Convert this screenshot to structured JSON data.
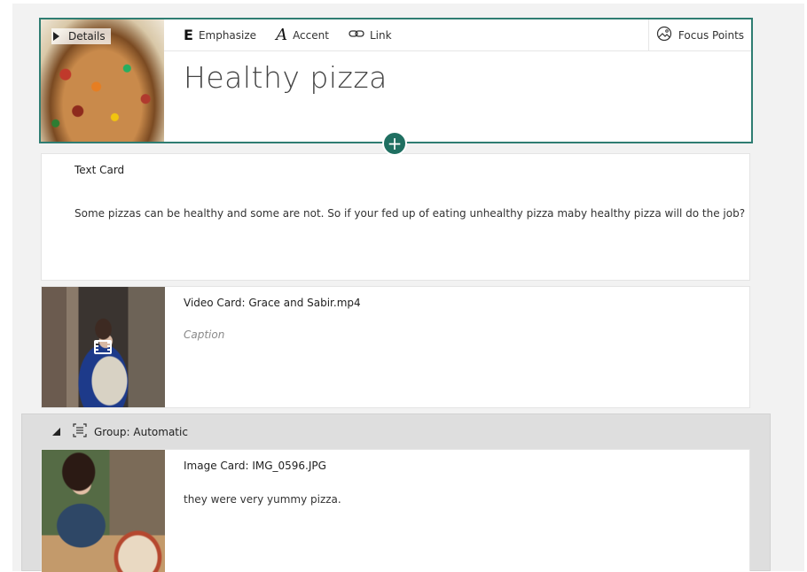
{
  "title_card": {
    "details_label": "Details",
    "toolbar": {
      "emphasize_glyph": "E",
      "emphasize_label": "Emphasize",
      "accent_glyph": "A",
      "accent_label": "Accent",
      "link_label": "Link",
      "focus_points_label": "Focus Points"
    },
    "title": "Healthy pizza",
    "add_symbol": "+"
  },
  "text_card": {
    "heading": "Text Card",
    "body": "Some pizzas can be healthy and some are not. So if your fed up of eating unhealthy pizza maby healthy pizza will do the job?"
  },
  "video_card": {
    "heading": "Video Card: Grace and Sabir.mp4",
    "caption_placeholder": "Caption"
  },
  "group": {
    "label": "Group: Automatic"
  },
  "image_card": {
    "heading": "Image Card: IMG_0596.JPG",
    "body": "they were very yummy pizza."
  },
  "colors": {
    "accent": "#2f7d72",
    "add_button": "#1f6f61",
    "canvas": "#f2f2f2",
    "group_bg": "#dedede"
  },
  "icons": {
    "details": "triangle-right-icon",
    "link": "link-icon",
    "focus_points": "focus-points-icon",
    "video": "film-icon",
    "group_collapse": "triangle-down-icon",
    "group_type": "group-icon"
  }
}
